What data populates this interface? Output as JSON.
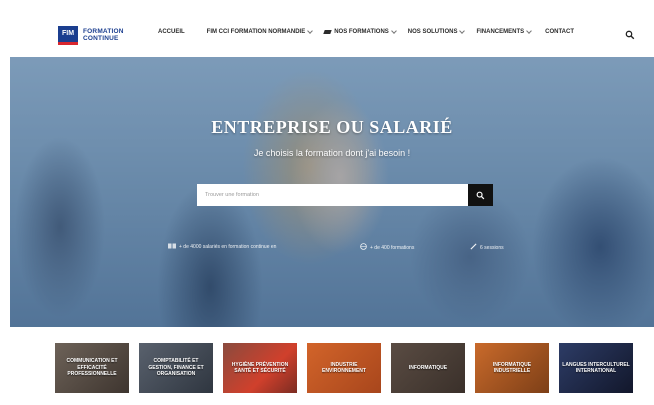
{
  "header": {
    "logo": {
      "mark": "FIM",
      "line1": "FORMATION",
      "line2": "CONTINUE"
    },
    "nav": [
      {
        "label": "ACCUEIL",
        "dropdown": false
      },
      {
        "label": "FIM CCI FORMATION NORMANDIE",
        "dropdown": true
      },
      {
        "label": "NOS FORMATIONS",
        "dropdown": true,
        "icon": "graduation-cap-icon"
      },
      {
        "label": "NOS SOLUTIONS",
        "dropdown": true
      },
      {
        "label": "FINANCEMENTS",
        "dropdown": true
      },
      {
        "label": "CONTACT",
        "dropdown": false
      }
    ],
    "search_icon": "search-icon"
  },
  "hero": {
    "title": "ENTREPRISE OU SALARIÉ",
    "subtitle": "Je choisis la formation dont j'ai besoin !",
    "search": {
      "placeholder": "Trouver une formation",
      "button_icon": "search-icon"
    },
    "stats": [
      {
        "icon": "book-icon",
        "text": "+ de 4000 salariés en formation continue en"
      },
      {
        "icon": "globe-icon",
        "text": "+ de 400 formations"
      },
      {
        "icon": "pen-icon",
        "text": "6 sessions"
      }
    ]
  },
  "categories": [
    {
      "label": "COMMUNICATION ET EFFICACITÉ PROFESSIONNELLE"
    },
    {
      "label": "COMPTABILITÉ ET GESTION, FINANCE ET ORGANISATION"
    },
    {
      "label": "HYGIÈNE PRÉVENTION SANTÉ ET SÉCURITÉ"
    },
    {
      "label": "INDUSTRIE ENVIRONNEMENT"
    },
    {
      "label": "INFORMATIQUE"
    },
    {
      "label": "INFORMATIQUE INDUSTRIELLE"
    },
    {
      "label": "LANGUES INTERCULTUREL INTERNATIONAL"
    }
  ],
  "colors": {
    "brand_blue": "#1b3e8f",
    "brand_red": "#d8262e",
    "search_button": "#111111"
  }
}
